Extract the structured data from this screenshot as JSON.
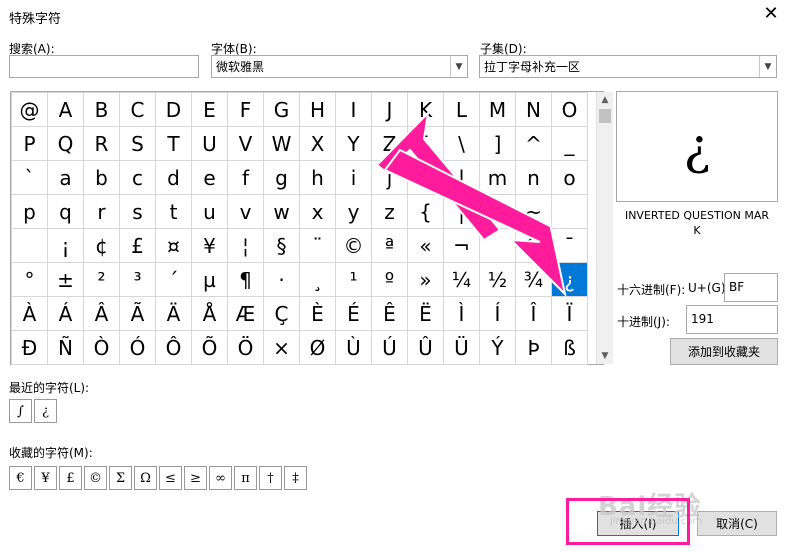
{
  "dialog": {
    "title": "特殊字符",
    "close_glyph": "✕"
  },
  "search": {
    "label": "搜索(A):",
    "value": ""
  },
  "font": {
    "label": "字体(B):",
    "value": "微软雅黑"
  },
  "subset": {
    "label": "子集(D):",
    "value": "拉丁字母补充一区"
  },
  "grid": {
    "rows": [
      [
        "@",
        "A",
        "B",
        "C",
        "D",
        "E",
        "F",
        "G",
        "H",
        "I",
        "J",
        "K",
        "L",
        "M",
        "N",
        "O"
      ],
      [
        "P",
        "Q",
        "R",
        "S",
        "T",
        "U",
        "V",
        "W",
        "X",
        "Y",
        "Z",
        "[",
        "\\",
        "]",
        "^",
        "_"
      ],
      [
        "`",
        "a",
        "b",
        "c",
        "d",
        "e",
        "f",
        "g",
        "h",
        "i",
        "j",
        "k",
        "l",
        "m",
        "n",
        "o"
      ],
      [
        "p",
        "q",
        "r",
        "s",
        "t",
        "u",
        "v",
        "w",
        "x",
        "y",
        "z",
        "{",
        "|",
        "}",
        "~",
        ""
      ],
      [
        "",
        "¡",
        "¢",
        "£",
        "¤",
        "¥",
        "¦",
        "§",
        "¨",
        "©",
        "ª",
        "«",
        "¬",
        "",
        "®",
        "¯"
      ],
      [
        "°",
        "±",
        "²",
        "³",
        "´",
        "µ",
        "¶",
        "·",
        "¸",
        "¹",
        "º",
        "»",
        "¼",
        "½",
        "¾",
        "¿"
      ],
      [
        "À",
        "Á",
        "Â",
        "Ã",
        "Ä",
        "Å",
        "Æ",
        "Ç",
        "È",
        "É",
        "Ê",
        "Ë",
        "Ì",
        "Í",
        "Î",
        "Ï"
      ],
      [
        "Ð",
        "Ñ",
        "Ò",
        "Ó",
        "Ô",
        "Õ",
        "Ö",
        "×",
        "Ø",
        "Ù",
        "Ú",
        "Û",
        "Ü",
        "Ý",
        "Þ",
        "ß"
      ]
    ],
    "selected": {
      "row": 5,
      "col": 15
    }
  },
  "preview": {
    "char": "¿",
    "name_line1": "INVERTED QUESTION MAR",
    "name_line2": "K"
  },
  "hex": {
    "label": "十六进制(F):",
    "prefix": "U+(G)",
    "value": "BF"
  },
  "dec": {
    "label": "十进制(J):",
    "value": "191"
  },
  "add_favorite": {
    "label": "添加到收藏夹"
  },
  "recent": {
    "label": "最近的字符(L):",
    "chars": [
      "∫",
      "¿"
    ]
  },
  "favorites": {
    "label": "收藏的字符(M):",
    "chars": [
      "€",
      "¥",
      "£",
      "©",
      "Σ",
      "Ω",
      "≤",
      "≥",
      "∞",
      "π",
      "†",
      "‡"
    ]
  },
  "buttons": {
    "insert": "插入(I)",
    "cancel": "取消(C)"
  },
  "annotation": {
    "arrow_color": "#ff1c9c",
    "highlight_color": "#ff1c9c"
  },
  "watermark": {
    "text": "Bai经验",
    "sub": "jingyan.baidu.com"
  }
}
